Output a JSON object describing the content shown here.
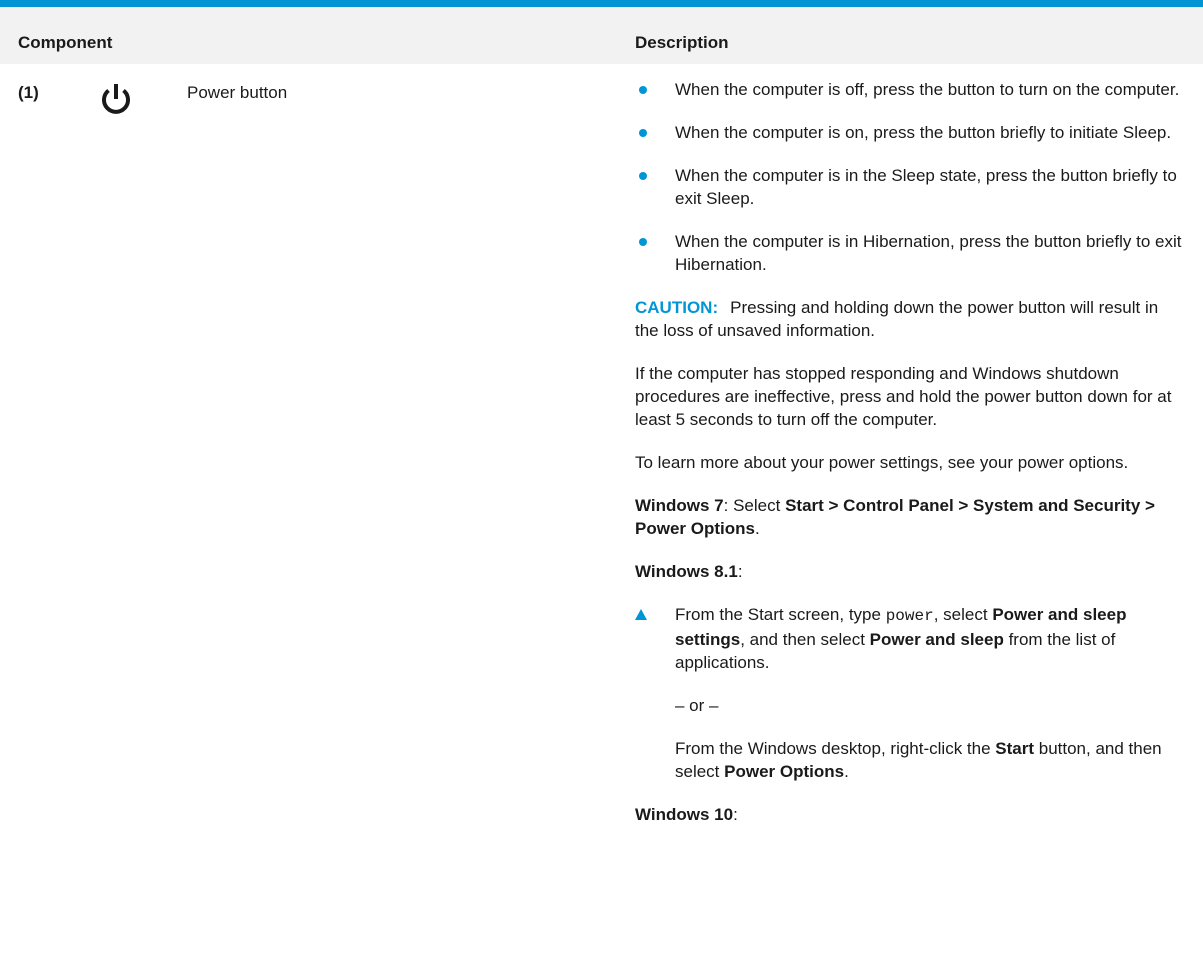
{
  "table": {
    "headers": {
      "component": "Component",
      "description": "Description"
    },
    "row": {
      "number": "(1)",
      "icon": "power-icon",
      "component_name": "Power button"
    }
  },
  "description": {
    "bullets": [
      "When the computer is off, press the button to turn on the computer.",
      "When the computer is on, press the button briefly to initiate Sleep.",
      "When the computer is in the Sleep state, press the button briefly to exit Sleep.",
      "When the computer is in Hibernation, press the button briefly to exit Hibernation."
    ],
    "caution": {
      "label": "CAUTION:",
      "text": "Pressing and holding down the power button will result in the loss of unsaved information."
    },
    "unresponsive_text": "If the computer has stopped responding and Windows shutdown procedures are ineffective, press and hold the power button down for at least 5 seconds to turn off the computer.",
    "learn_more_text": "To learn more about your power settings, see your power options.",
    "win7": {
      "label": "Windows 7",
      "colon": ": Select ",
      "path_1": "Start > Control Panel > System and Security > Power Options",
      "end": "."
    },
    "win81": {
      "label": "Windows 8.1",
      "colon": ":",
      "step_1": {
        "prefix": "From the Start screen, type ",
        "typed": "power",
        "middle_1": ", select ",
        "bold_1": "Power and sleep settings",
        "middle_2": ", and then select ",
        "bold_2": "Power and sleep",
        "suffix": " from the list of applications."
      },
      "or_text": "– or –",
      "step_2": {
        "prefix": "From the Windows desktop, right-click the ",
        "bold_1": "Start",
        "middle": " button, and then select ",
        "bold_2": "Power Options",
        "suffix": "."
      }
    },
    "win10": {
      "label": "Windows 10",
      "colon": ":"
    }
  },
  "colors": {
    "accent": "#0096d6",
    "header_bg": "#f2f2f2",
    "text": "#1a1a1a"
  }
}
